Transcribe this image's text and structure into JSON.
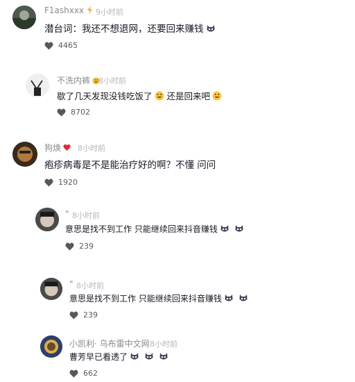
{
  "comments": [
    {
      "name": "F1ashxxx",
      "time": "9小时前",
      "text": "潜台词：我还不想退网，还要回来赚钱",
      "likes": "4465",
      "avatar_color": "#3d4a3a"
    },
    {
      "name": "不洗内裤",
      "time": "8小时前",
      "text_a": "歇了几天发现没钱吃饭了",
      "text_b": "还是回来吧",
      "likes": "8702",
      "avatar_color": "#e9e9e9"
    },
    {
      "name": "狗焕",
      "time": "8小时前",
      "text": "疱疹病毒是不是能治疗好的啊？不懂 问问",
      "likes": "1920",
      "avatar_color": "#7a4a24"
    },
    {
      "name": "\"",
      "time": "8小时前",
      "text": "意思是找不到工作 只能继续回来抖音赚钱",
      "likes": "239",
      "avatar_color": "#3a3a3a"
    },
    {
      "name": "\"",
      "time": "8小时前",
      "text": "意思是找不到工作 只能继续回来抖音赚钱",
      "likes": "239",
      "avatar_color": "#3a3a3a"
    },
    {
      "name": "小凯利",
      "watermark": "· 乌布雷中文网",
      "time": "8小时前",
      "text": "曹芳早已看透了",
      "likes": "662",
      "avatar_color": "#2e3f6a"
    }
  ],
  "icons": {
    "like": "heart-icon",
    "verified": "lightning-badge-icon",
    "heart_badge": "red-heart-icon",
    "cat_emoji": "cat-emoji-icon",
    "smile_emoji": "grin-emoji-icon"
  },
  "colors": {
    "name": "#8a8b91",
    "time": "#b5b6ba",
    "text": "#161823",
    "like_icon": "#57585d",
    "badge_red": "#e0283a",
    "emoji_yellow": "#f7c640"
  }
}
